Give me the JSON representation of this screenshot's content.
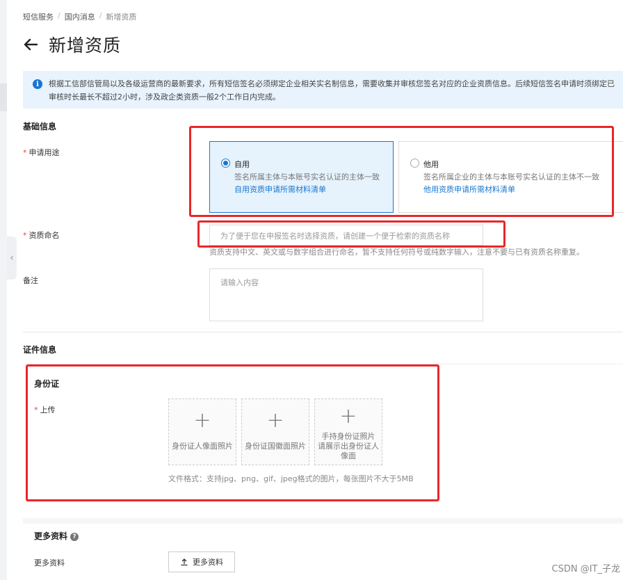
{
  "breadcrumb": {
    "items": [
      "短信服务",
      "国内消息",
      "新增资质"
    ],
    "separator": "/"
  },
  "page": {
    "title": "新增资质",
    "back_icon": "arrow-left-icon"
  },
  "notice": {
    "icon": "info-icon",
    "icon_glyph": "i",
    "line1": "根据工信部信管局以及各级运营商的最新要求，所有短信签名必须绑定企业相关实名制信息，需要收集并审核您签名对应的企业资质信息。后续短信签名申请时须绑定已",
    "line2": "审核时长最长不超过2小时，涉及政企类资质一般2个工作日内完成。"
  },
  "basic_info": {
    "section_title": "基础信息",
    "purpose_label": "申请用途",
    "purpose_required": "*",
    "options": [
      {
        "title": "自用",
        "desc": "签名所属主体与本账号实名认证的主体一致",
        "link": "自用资质申请所需材料清单",
        "selected": true
      },
      {
        "title": "他用",
        "desc": "签名所属企业的主体与本账号实名认证的主体不一致",
        "link": "他用资质申请所需材料清单",
        "selected": false
      }
    ],
    "name_label": "资质命名",
    "name_required": "*",
    "name_placeholder": "为了便于您在申报签名时选择资质，请创建一个便于检索的资质名称",
    "name_hint": "资质支持中文、英文或与数字组合进行命名，暂不支持任何符号或纯数字输入，注意不要与已有资质名称重复。",
    "remark_label": "备注",
    "remark_placeholder": "请输入内容"
  },
  "certificate_info": {
    "section_title": "证件信息",
    "id_card_title": "身份证",
    "upload_label": "上传",
    "upload_required": "*",
    "upload_icon": "plus-icon",
    "upload_glyph": "+",
    "uploads": [
      {
        "caption": "身份证人像面照片"
      },
      {
        "caption": "身份证国徽面照片"
      },
      {
        "caption_lines": [
          "手持身份证照片",
          "请展示出身份证人",
          "像面"
        ]
      }
    ],
    "file_hint": "文件格式：支持jpg、png、gif、jpeg格式的图片，每张图片不大于5MB"
  },
  "more_info": {
    "section_title": "更多资料",
    "help_icon": "question-circle-icon",
    "help_glyph": "?",
    "field_label": "更多资料",
    "button_label": "更多资料",
    "button_icon": "upload-icon"
  },
  "watermark": "CSDN @IT_子龙",
  "colors": {
    "primary": "#1677d2",
    "notice_bg": "#e9f3fd",
    "selected_bg": "#e6f2fc",
    "required": "#e5483b",
    "annotation_red": "#e8262a"
  }
}
